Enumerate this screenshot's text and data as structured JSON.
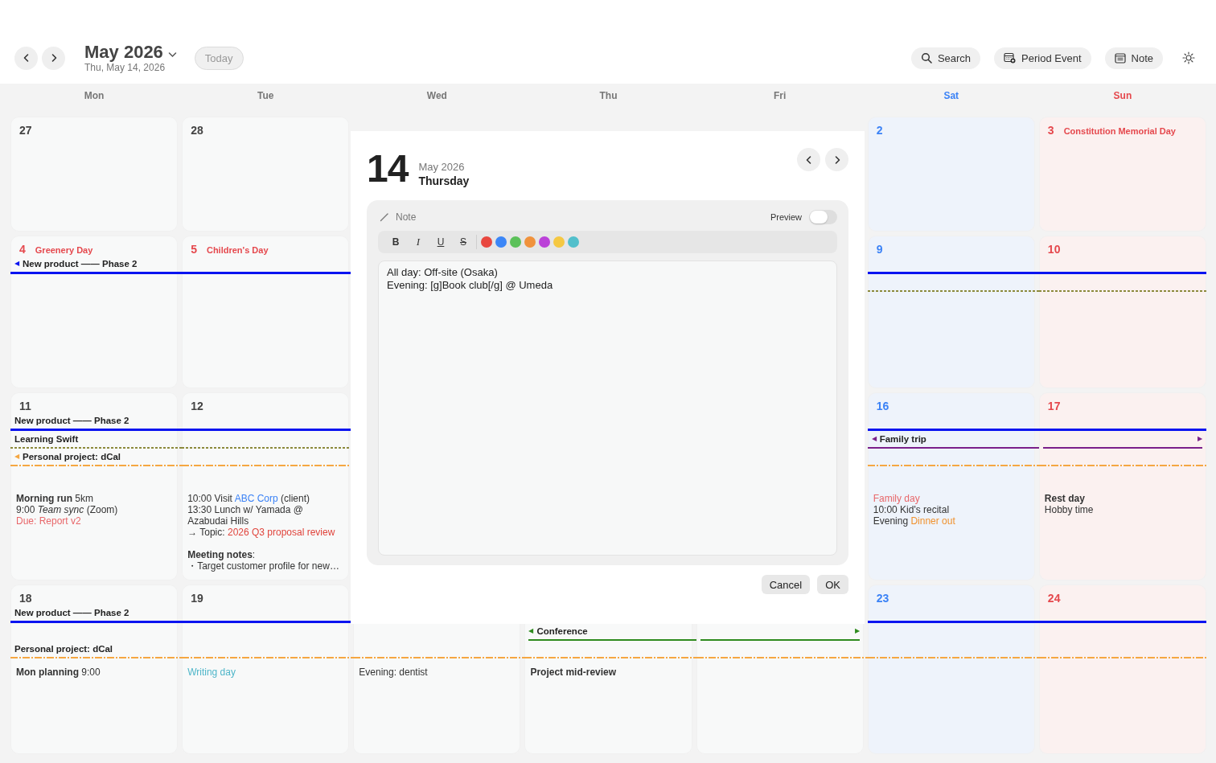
{
  "header": {
    "title": "May 2026",
    "subtitle": "Thu, May 14, 2026",
    "today": {
      "label": "Today",
      "disabled": true
    },
    "actions": [
      {
        "label": "Search",
        "kind": "search"
      },
      {
        "label": "Period Event",
        "kind": "calendar"
      },
      {
        "label": "Note",
        "kind": "note"
      }
    ]
  },
  "weekdays": [
    {
      "label": "Mon",
      "kind": "weekday"
    },
    {
      "label": "Tue",
      "kind": "weekday"
    },
    {
      "label": "Wed",
      "kind": "weekday"
    },
    {
      "label": "Thu",
      "kind": "weekday"
    },
    {
      "label": "Fri",
      "kind": "weekday"
    },
    {
      "label": "Sat",
      "kind": "saturday"
    },
    {
      "label": "Sun",
      "kind": "sunday"
    }
  ],
  "weeks": [
    {
      "days": [
        {
          "day": "27"
        },
        {
          "day": "28"
        },
        {
          "kind": "covered"
        },
        {
          "kind": "covered"
        },
        {
          "kind": "covered"
        },
        {
          "day": "2"
        },
        {
          "day": "3",
          "holiday": "Constitution Memorial Day"
        }
      ]
    },
    {
      "days": [
        {
          "day": "4",
          "holiday": "Greenery Day"
        },
        {
          "day": "5",
          "holiday": "Children's Day"
        },
        {
          "kind": "covered"
        },
        {
          "kind": "covered"
        },
        {
          "kind": "covered"
        },
        {
          "day": "9"
        },
        {
          "day": "10"
        }
      ],
      "lanes": [
        {
          "pieces": [
            {
              "kind": "bold",
              "color": "#0a14f0",
              "start_mark": "◀",
              "label": "New product —— Phase 2"
            },
            {
              "kind": "bold",
              "color": "#0a14f0"
            },
            {
              "kind": "covered"
            },
            {
              "kind": "covered"
            },
            {
              "kind": "covered"
            },
            {
              "kind": "bold",
              "color": "#0a14f0"
            },
            {
              "kind": "bold",
              "color": "#0a14f0"
            }
          ]
        },
        {
          "pieces": [
            {
              "kind": "none"
            },
            {
              "kind": "none"
            },
            {
              "kind": "covered"
            },
            {
              "kind": "covered"
            },
            {
              "kind": "covered"
            },
            {
              "kind": "dotted",
              "color": "#8c8a3c"
            },
            {
              "kind": "dotted",
              "color": "#8c8a3c"
            }
          ]
        }
      ]
    },
    {
      "days": [
        {
          "day": "11",
          "notes": [
            [
              {
                "text": "**Morning run** 5km"
              }
            ],
            [
              {
                "text": "9:00 *Team sync* (Zoom)"
              }
            ],
            [
              {
                "text": "Due: Report v2",
                "color": "#e8676a"
              }
            ]
          ]
        },
        {
          "day": "12",
          "notes": [
            [
              {
                "text": "10:00 Visit "
              },
              {
                "text": "ABC Corp",
                "color": "#3b82f6"
              },
              {
                "text": " (client)"
              }
            ],
            [
              {
                "text": "13:30 Lunch w/ Yamada @"
              }
            ],
            [
              {
                "text": "Azabudai Hills"
              }
            ],
            [
              {
                "text": "→ Topic: "
              },
              {
                "text": "2026 Q3 proposal review",
                "color": "#e0443c"
              }
            ],
            {
              "kind": "heading",
              "segments": [
                {
                  "text": "**Meeting notes**:"
                }
              ]
            },
            [
              {
                "text": "・Target customer profile for new…"
              }
            ]
          ]
        },
        {
          "kind": "covered"
        },
        {
          "kind": "covered"
        },
        {
          "kind": "covered"
        },
        {
          "day": "16",
          "notes": [
            [
              {
                "text": "Family day",
                "color": "#e8676a"
              }
            ],
            [
              {
                "text": "10:00 Kid's recital"
              }
            ],
            [
              {
                "text": "Evening "
              },
              {
                "text": "Dinner out",
                "color": "#f0922f"
              }
            ]
          ]
        },
        {
          "day": "17",
          "notes": [
            [
              {
                "text": "**Rest day**"
              }
            ],
            [
              {
                "text": "Hobby time"
              }
            ]
          ]
        }
      ],
      "lanes": [
        {
          "pieces": [
            {
              "kind": "bold",
              "color": "#0a14f0",
              "label": "New product —— Phase 2"
            },
            {
              "kind": "bold",
              "color": "#0a14f0"
            },
            {
              "kind": "covered"
            },
            {
              "kind": "covered"
            },
            {
              "kind": "covered"
            },
            {
              "kind": "bold",
              "color": "#0a14f0"
            },
            {
              "kind": "bold",
              "color": "#0a14f0"
            }
          ]
        },
        {
          "pieces": [
            {
              "kind": "dotted",
              "color": "#8c8a3c",
              "label": "Learning Swift"
            },
            {
              "kind": "dotted",
              "color": "#8c8a3c"
            },
            {
              "kind": "covered"
            },
            {
              "kind": "covered"
            },
            {
              "kind": "covered"
            },
            {
              "kind": "solid",
              "color": "#7a1f8a",
              "start_mark": "◀",
              "label": "Family trip"
            },
            {
              "kind": "solid",
              "color": "#7a1f8a",
              "end_mark": "▶"
            }
          ]
        },
        {
          "pieces": [
            {
              "kind": "dashdot",
              "color": "#f5a742",
              "start_mark": "◀",
              "label": "Personal project: dCal"
            },
            {
              "kind": "dashdot",
              "color": "#f5a742"
            },
            {
              "kind": "covered"
            },
            {
              "kind": "covered"
            },
            {
              "kind": "covered"
            },
            {
              "kind": "dashdot",
              "color": "#f5a742"
            },
            {
              "kind": "dashdot",
              "color": "#f5a742"
            }
          ]
        }
      ]
    },
    {
      "days": [
        {
          "day": "18",
          "notes": [
            [
              {
                "text": "**Mon planning** 9:00"
              }
            ]
          ]
        },
        {
          "day": "19",
          "notes": [
            [
              {
                "text": "Writing day",
                "color": "#4fb6c9"
              }
            ]
          ]
        },
        {
          "notes": [
            [
              {
                "text": "Evening: dentist"
              }
            ]
          ]
        },
        {
          "notes": [
            [
              {
                "text": "**Project mid-review**"
              }
            ]
          ]
        },
        {
          "kind": "blank"
        },
        {
          "day": "23"
        },
        {
          "day": "24"
        }
      ],
      "lanes": [
        {
          "pieces": [
            {
              "kind": "bold",
              "color": "#0a14f0",
              "label": "New product —— Phase 2"
            },
            {
              "kind": "bold",
              "color": "#0a14f0"
            },
            {
              "kind": "covered"
            },
            {
              "kind": "covered"
            },
            {
              "kind": "covered"
            },
            {
              "kind": "bold",
              "color": "#0a14f0"
            },
            {
              "kind": "bold",
              "color": "#0a14f0"
            }
          ]
        },
        {
          "pieces": [
            {
              "kind": "none"
            },
            {
              "kind": "none"
            },
            {
              "kind": "none"
            },
            {
              "kind": "solid",
              "color": "#2e8b1e",
              "start_mark": "◀",
              "label": "Conference"
            },
            {
              "kind": "solid",
              "color": "#2e8b1e",
              "end_mark": "▶"
            },
            {
              "kind": "none"
            },
            {
              "kind": "none"
            }
          ]
        },
        {
          "pieces": [
            {
              "kind": "dashdot",
              "color": "#f5a742",
              "label": "Personal project: dCal"
            },
            {
              "kind": "dashdot",
              "color": "#f5a742"
            },
            {
              "kind": "dashdot",
              "color": "#f5a742"
            },
            {
              "kind": "dashdot",
              "color": "#f5a742"
            },
            {
              "kind": "dashdot",
              "color": "#f5a742"
            },
            {
              "kind": "dashdot",
              "color": "#f5a742"
            },
            {
              "kind": "dashdot",
              "color": "#f5a742"
            }
          ]
        }
      ]
    }
  ],
  "modal": {
    "day": "14",
    "month": "May 2026",
    "weekday": "Thursday",
    "note": {
      "title": "Note",
      "preview": {
        "label": "Preview",
        "on": false
      },
      "format_buttons": [
        {
          "label": "B",
          "kind": "bold"
        },
        {
          "label": "I",
          "kind": "italic"
        },
        {
          "label": "U",
          "kind": "underline"
        },
        {
          "label": "S",
          "kind": "strike"
        }
      ],
      "colors": [
        {
          "color": "#e8473f"
        },
        {
          "color": "#3b86f7"
        },
        {
          "color": "#5cc15a"
        },
        {
          "color": "#f0923c"
        },
        {
          "color": "#bb42d8"
        },
        {
          "color": "#f5c842"
        },
        {
          "color": "#52bfcb"
        }
      ],
      "text": "All day: Off-site (Osaka)\nEvening: [g]Book club[/g] @ Umeda"
    },
    "buttons": [
      {
        "label": "Cancel"
      },
      {
        "label": "OK"
      }
    ]
  }
}
